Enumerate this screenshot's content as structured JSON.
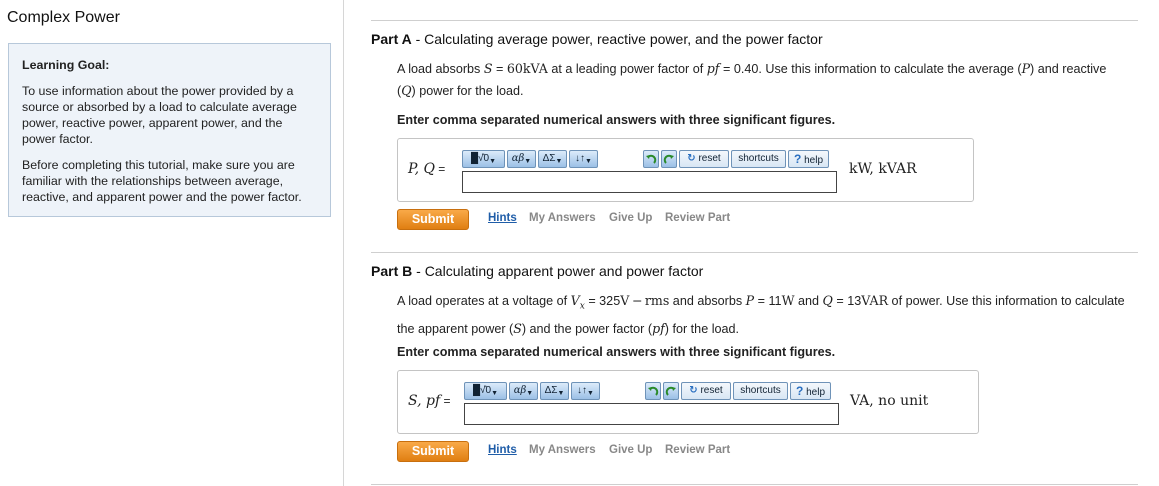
{
  "page": {
    "title": "Complex Power"
  },
  "learning_goal": {
    "heading": "Learning Goal:",
    "paragraphs": [
      "To use information about the power provided by a source or absorbed by a load to calculate average power, reactive power, apparent power, and the power factor.",
      "Before completing this tutorial, make sure you are familiar with the relationships between average, reactive, and apparent power and the power factor."
    ]
  },
  "toolbar": {
    "templates": "█√̆0",
    "greek": "αβ",
    "symbols": "ΔΣ",
    "arrows": "↓↑",
    "undo_icon": "undo-icon",
    "redo_icon": "redo-icon",
    "reset": "reset",
    "shortcuts": "shortcuts",
    "help": "help",
    "help_glyph": "?"
  },
  "parts": [
    {
      "label": "Part A",
      "separator": " - ",
      "title": "Calculating average power, reactive power, and the power factor",
      "problem": {
        "t1": "A load absorbs ",
        "m1": "S",
        "t2": " = ",
        "m2": "60kVA",
        "t3": " at a leading power factor of ",
        "m3": "pf",
        "t4": " = 0.40. Use this information to calculate the average (",
        "m4": "P",
        "t5": ") and reactive (",
        "m5": "Q",
        "t6": ") power for the load."
      },
      "instruction": "Enter comma separated numerical answers with three significant figures.",
      "variable_label": "P, Q",
      "equals": " =",
      "input_value": "",
      "units": "kW, kVAR",
      "actions": {
        "submit": "Submit",
        "hints": "Hints",
        "my_answers": "My Answers",
        "give_up": "Give Up",
        "review": "Review Part"
      }
    },
    {
      "label": "Part B",
      "separator": " - ",
      "title": "Calculating apparent power and power factor",
      "problem": {
        "t1": "A load operates at a voltage of ",
        "m1": "V",
        "sub": "x",
        "t2": " = 325",
        "m2": "V − rms",
        "t3": " and absorbs ",
        "m3": "P",
        "t4": " = 11",
        "m4": "W",
        "t5": " and ",
        "m5": "Q",
        "t6": " = 13",
        "m6": "VAR",
        "t7": " of power. Use this information to calculate the apparent power (",
        "m7": "S",
        "t8": ") and the power factor (",
        "m8": "pf",
        "t9": ") for the load."
      },
      "instruction": "Enter comma separated numerical answers with three significant figures.",
      "variable_label": "S, pf",
      "equals": " =",
      "input_value": "",
      "units": "VA, no unit",
      "actions": {
        "submit": "Submit",
        "hints": "Hints",
        "my_answers": "My Answers",
        "give_up": "Give Up",
        "review": "Review Part"
      }
    }
  ]
}
